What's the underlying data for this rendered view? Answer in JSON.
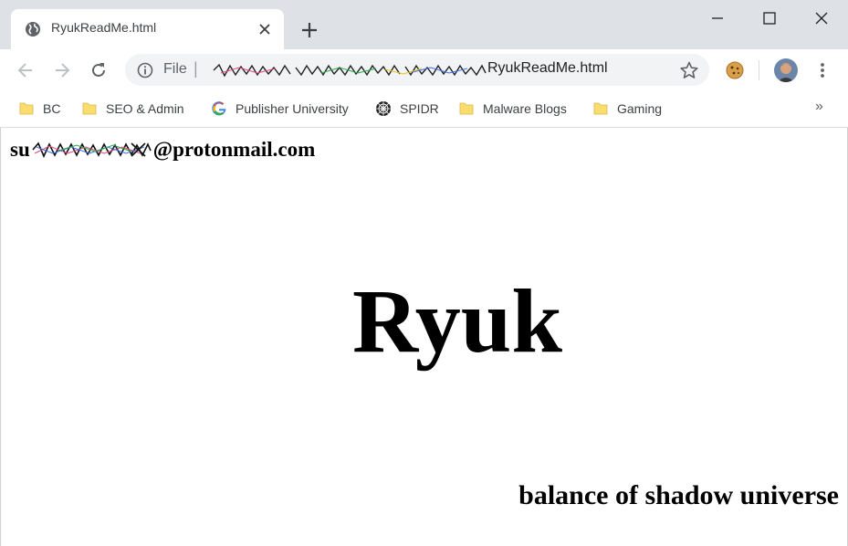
{
  "window": {
    "tab_title": "RyukReadMe.html",
    "tab_icon": "globe-icon",
    "controls": [
      "minimize-icon",
      "maximize-icon",
      "close-icon"
    ]
  },
  "toolbar": {
    "url_scheme_label": "File",
    "url_separator": "|",
    "url_visible_path": "RyukReadMe.html",
    "accent_color": "#5f6368"
  },
  "bookmarks": {
    "items": [
      {
        "label": "BC",
        "icon": "folder-icon"
      },
      {
        "label": "SEO & Admin",
        "icon": "folder-icon"
      },
      {
        "label": "Publisher University",
        "icon": "google-g-icon"
      },
      {
        "label": "SPIDR",
        "icon": "spider-web-icon"
      },
      {
        "label": "Malware Blogs",
        "icon": "folder-icon"
      },
      {
        "label": "Gaming",
        "icon": "folder-icon"
      }
    ],
    "more_label": "»",
    "folder_color": "#fbdd6d"
  },
  "page": {
    "email_prefix": "su",
    "email_domain": "@protonmail.com",
    "headline": "Ryuk",
    "tagline": "balance of shadow universe"
  }
}
